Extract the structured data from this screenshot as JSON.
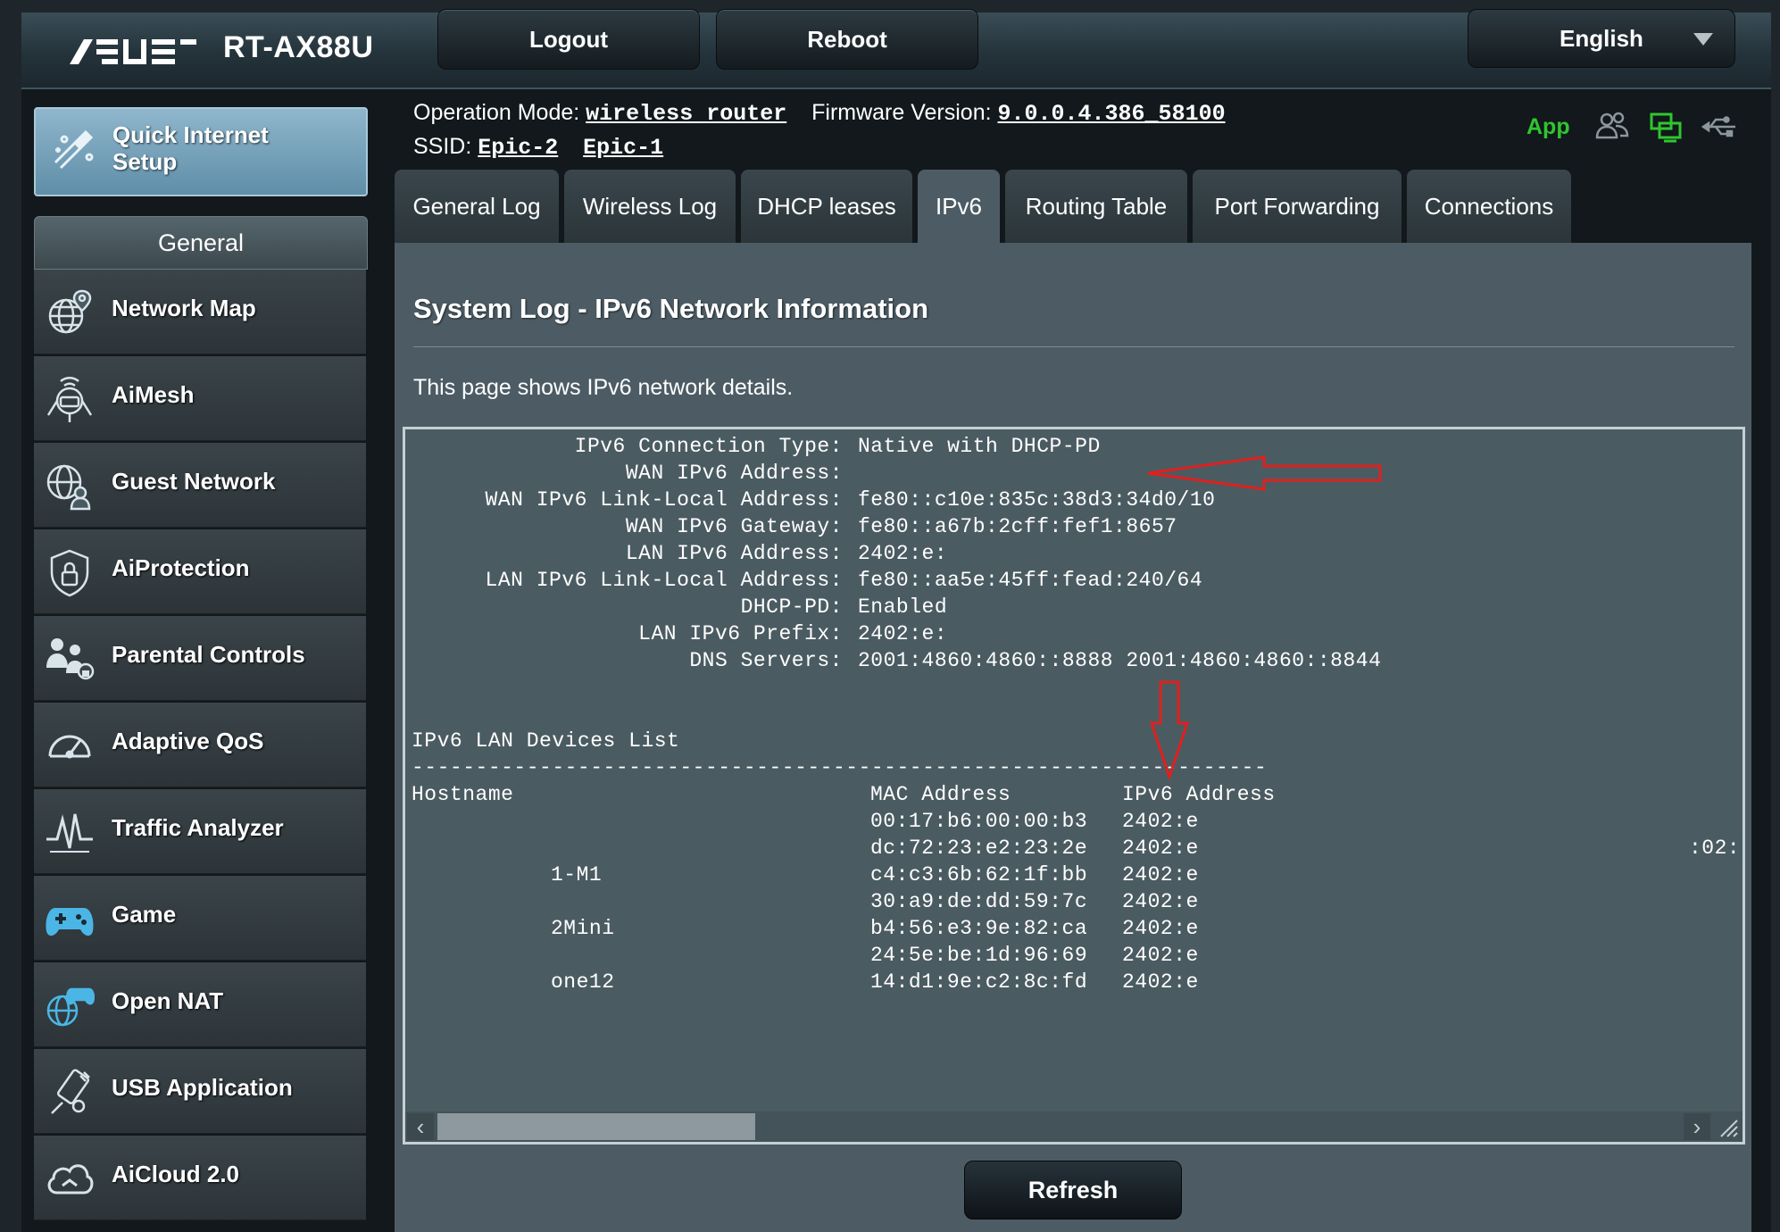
{
  "header": {
    "model": "RT-AX88U",
    "logout_label": "Logout",
    "reboot_label": "Reboot",
    "language": "English"
  },
  "info": {
    "op_mode_label": "Operation Mode:",
    "op_mode_value": "wireless router",
    "fw_label": "Firmware Version:",
    "fw_value": "9.0.0.4.386_58100",
    "ssid_label": "SSID:",
    "ssid_1": "Epic-2",
    "ssid_2": "Epic-1",
    "app_label": "App"
  },
  "sidebar": {
    "qis_label": "Quick Internet Setup",
    "general_header": "General",
    "items": [
      {
        "label": "Network Map"
      },
      {
        "label": "AiMesh"
      },
      {
        "label": "Guest Network"
      },
      {
        "label": "AiProtection"
      },
      {
        "label": "Parental Controls"
      },
      {
        "label": "Adaptive QoS"
      },
      {
        "label": "Traffic Analyzer"
      },
      {
        "label": "Game"
      },
      {
        "label": "Open NAT"
      },
      {
        "label": "USB Application"
      },
      {
        "label": "AiCloud 2.0"
      }
    ]
  },
  "tabs": [
    {
      "label": "General Log"
    },
    {
      "label": "Wireless Log"
    },
    {
      "label": "DHCP leases"
    },
    {
      "label": "IPv6"
    },
    {
      "label": "Routing Table"
    },
    {
      "label": "Port Forwarding"
    },
    {
      "label": "Connections"
    }
  ],
  "main": {
    "title": "System Log - IPv6 Network Information",
    "description": "This page shows IPv6 network details.",
    "info_rows": [
      {
        "key": "IPv6 Connection Type:",
        "value": "Native with DHCP-PD"
      },
      {
        "key": "WAN IPv6 Address:",
        "value": ""
      },
      {
        "key": "WAN IPv6 Link-Local Address:",
        "value": "fe80::c10e:835c:38d3:34d0/10"
      },
      {
        "key": "WAN IPv6 Gateway:",
        "value": "fe80::a67b:2cff:fef1:8657"
      },
      {
        "key": "LAN IPv6 Address:",
        "value": "2402:e:"
      },
      {
        "key": "LAN IPv6 Link-Local Address:",
        "value": "fe80::aa5e:45ff:fead:240/64"
      },
      {
        "key": "DHCP-PD:",
        "value": "Enabled"
      },
      {
        "key": "LAN IPv6 Prefix:",
        "value": "2402:e:"
      },
      {
        "key": "DNS Servers:",
        "value": "2001:4860:4860::8888 2001:4860:4860::8844"
      }
    ],
    "devices_title": "IPv6 LAN Devices List",
    "divider": "-------------------------------------------------------------------",
    "col_hostname": "Hostname",
    "col_mac": "MAC Address",
    "col_ipv6": "IPv6 Address",
    "devices": [
      {
        "host": "",
        "mac": "00:17:b6:00:00:b3",
        "ip": "2402:e"
      },
      {
        "host": "",
        "mac": "dc:72:23:e2:23:2e",
        "ip": "2402:e"
      },
      {
        "host": "1-M1",
        "mac": "c4:c3:6b:62:1f:bb",
        "ip": "2402:e"
      },
      {
        "host": "",
        "mac": "30:a9:de:dd:59:7c",
        "ip": "2402:e"
      },
      {
        "host": "2Mini",
        "mac": "b4:56:e3:9e:82:ca",
        "ip": "2402:e"
      },
      {
        "host": "",
        "mac": "24:5e:be:1d:96:69",
        "ip": "2402:e"
      },
      {
        "host": "one12",
        "mac": "14:d1:9e:c2:8c:fd",
        "ip": "2402:e"
      }
    ],
    "overflow_text": ":02:",
    "refresh_label": "Refresh"
  },
  "colors": {
    "accent_green": "#2fc62f",
    "annotation_red": "#e0201e",
    "content_bg": "#4d5c64"
  }
}
